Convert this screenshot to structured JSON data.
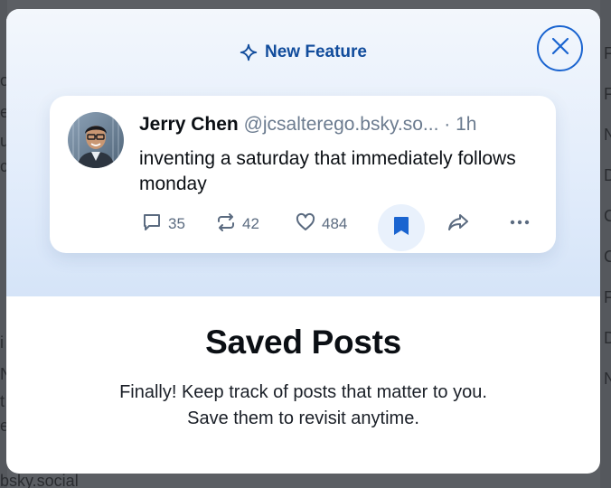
{
  "background": {
    "left_fragments": [
      "o",
      "e",
      "u",
      "c",
      "i",
      "N",
      "t",
      "e"
    ],
    "right_fragments": [
      "F",
      "F",
      "N",
      "D",
      "C",
      "C",
      "F",
      "D",
      "N"
    ],
    "bottom_text": "bsky.social"
  },
  "modal": {
    "feature_tag": "New Feature",
    "feature_icon": "sparkle-icon",
    "close_icon": "close-icon",
    "title": "Saved Posts",
    "description_line1": "Finally! Keep track of posts that matter to you.",
    "description_line2": "Save them to revisit anytime."
  },
  "post": {
    "author_name": "Jerry Chen",
    "author_handle": "@jcsalterego.bsky.so...",
    "separator": "·",
    "time": "1h",
    "text": "inventing a saturday that immediately follows monday",
    "actions": {
      "reply_count": "35",
      "repost_count": "42",
      "like_count": "484"
    }
  },
  "colors": {
    "accent": "#1a64d0",
    "feature_text": "#114c9c",
    "muted": "#6b7b8f"
  }
}
